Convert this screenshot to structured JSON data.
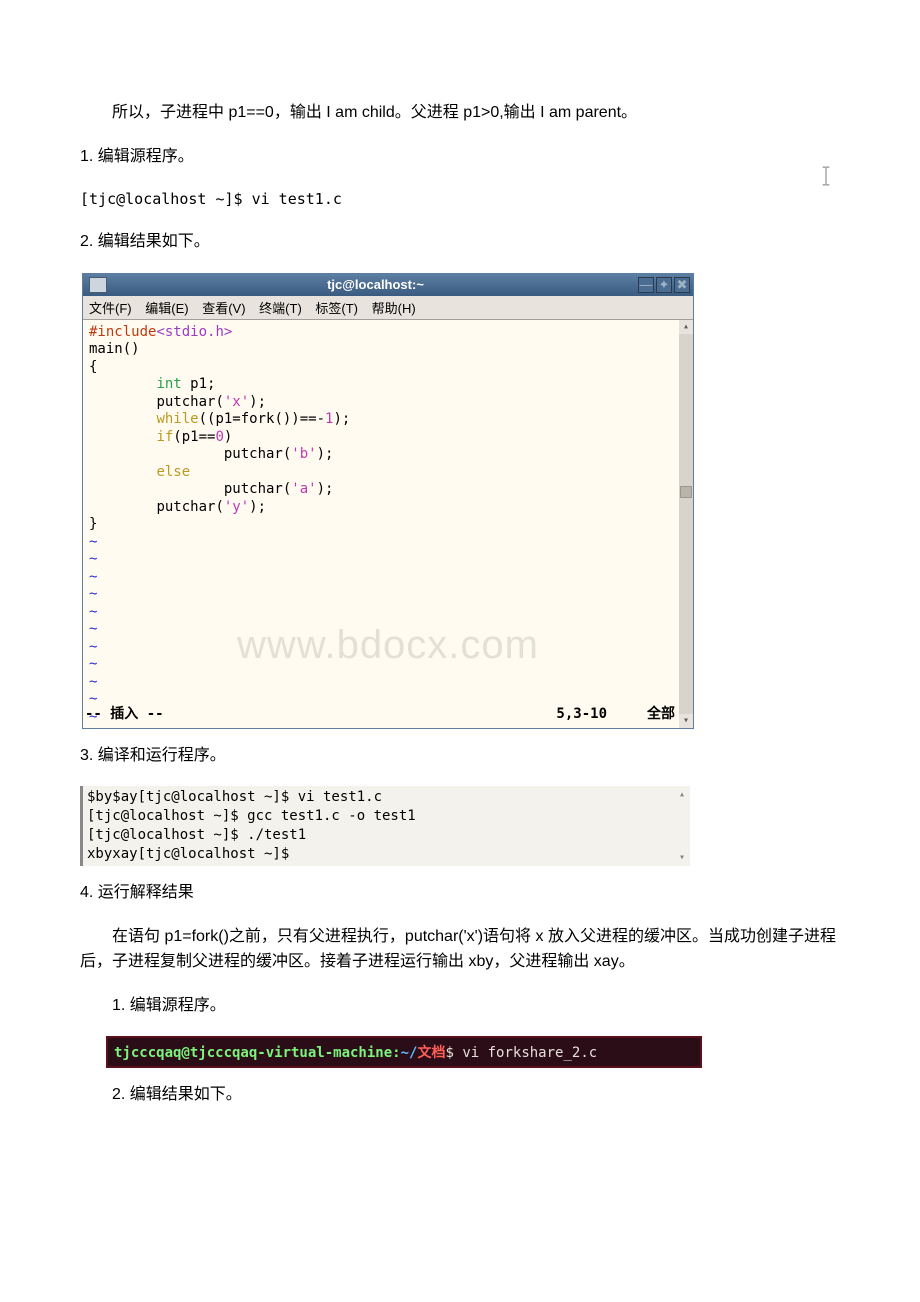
{
  "para1": " 所以，子进程中 p1==0，输出 I am child。父进程 p1>0,输出 I am parent。",
  "step1": "1. 编辑源程序。",
  "cmd1": "[tjc@localhost ~]$ vi test1.c",
  "step2": "2. 编辑结果如下。",
  "term": {
    "title": "tjc@localhost:~",
    "menu": {
      "file": "文件(F)",
      "edit": "编辑(E)",
      "view": "查看(V)",
      "terminal": "终端(T)",
      "tabs": "标签(T)",
      "help": "帮助(H)"
    },
    "code": {
      "l1a": "#include",
      "l1b": "<stdio.h>",
      "l2": "main()",
      "l3": "{",
      "l4a": "int",
      "l4b": " p1;",
      "l5": "putchar(",
      "l5c": "'x'",
      "l5e": ");",
      "l6a": "while",
      "l6b": "((p1=fork())==-",
      "l6n": "1",
      "l6e": ");",
      "l7a": "if",
      "l7b": "(p1==",
      "l7n": "0",
      "l7e": ")",
      "l8": "putchar(",
      "l8c": "'b'",
      "l8e": ");",
      "l9": "else",
      "l10": "putchar(",
      "l10c": "'a'",
      "l10e": ");",
      "l11": "putchar(",
      "l11c": "'y'",
      "l11e": ");",
      "l12": "}"
    },
    "insert": "-- 插入 --",
    "pos": "5,3-10",
    "range": "全部",
    "watermark": "www.bdocx.com"
  },
  "step3": "3. 编译和运行程序。",
  "block2": {
    "l1": "$by$ay[tjc@localhost ~]$ vi test1.c",
    "l2": "[tjc@localhost ~]$ gcc test1.c -o test1",
    "l3": "[tjc@localhost ~]$ ./test1",
    "l4": "xbyxay[tjc@localhost ~]$"
  },
  "step4": "4. 运行解释结果",
  "para2": "在语句 p1=fork()之前，只有父进程执行，putchar('x')语句将 x 放入父进程的缓冲区。当成功创建子进程后，子进程复制父进程的缓冲区。接着子进程运行输出 xby，父进程输出 xay。",
  "step5": "1. 编辑源程序。",
  "ubuntu": {
    "user": "tjcccqaq@tjcccqaq-virtual-machine",
    "colon": ":",
    "tilde": "~/",
    "pathzh": "文档",
    "dollar": "$ ",
    "cmd": "vi forkshare_2.c"
  },
  "step6": "2. 编辑结果如下。"
}
